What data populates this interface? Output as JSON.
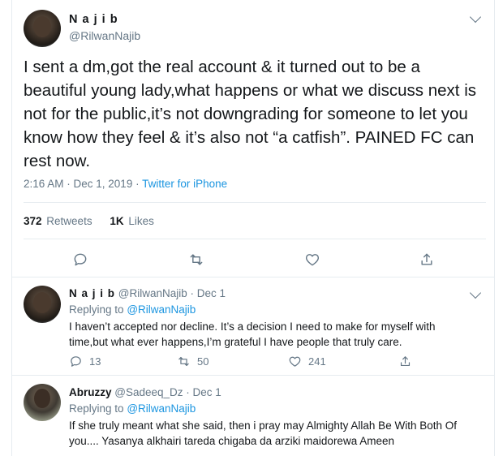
{
  "main_tweet": {
    "display_name": "N a j i b",
    "handle": "@RilwanNajib",
    "text": "I sent a dm,got the real account & it turned out to be a beautiful young lady,what happens or what we discuss next is not for the public,it’s not downgrading for someone to let you know how they feel & it’s also not “a catfish”. PAINED FC can rest now.",
    "timestamp": "2:16 AM · Dec 1, 2019 ·",
    "source": "Twitter for iPhone",
    "retweets_count": "372",
    "retweets_label": "Retweets",
    "likes_count": "1K",
    "likes_label": "Likes",
    "actions": [
      "reply-icon",
      "retweet-icon",
      "like-icon",
      "share-icon"
    ]
  },
  "replies": [
    {
      "display_name": "N a j i b",
      "handle_date": "@RilwanNajib · Dec 1",
      "replying_prefix": "Replying to",
      "replying_to": "@RilwanNajib",
      "text": "I haven’t accepted nor decline. It’s a decision I need to make for myself with time,but what ever happens,I’m grateful I have people that truly care.",
      "reply_count": "13",
      "retweet_count": "50",
      "like_count": "241"
    },
    {
      "display_name": "Abruzzy",
      "handle_date": "@Sadeeq_Dz · Dec 1",
      "replying_prefix": "Replying to",
      "replying_to": "@RilwanNajib",
      "text": "If she truly meant what she said, then i  pray may Almighty Allah Be With Both Of you.... Yasanya alkhairi tareda chigaba da arziki maidorewa Ameen"
    }
  ]
}
